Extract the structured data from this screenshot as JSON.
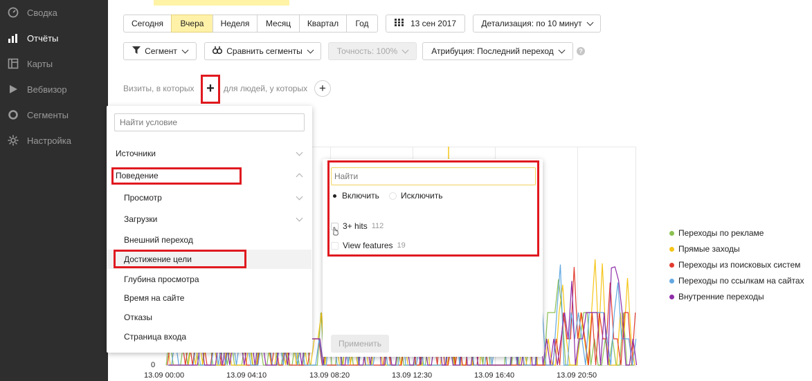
{
  "sidebar": {
    "items": [
      {
        "label": "Сводка",
        "icon": "gauge-icon",
        "active": false
      },
      {
        "label": "Отчёты",
        "icon": "bar-chart-icon",
        "active": true
      },
      {
        "label": "Карты",
        "icon": "map-icon",
        "active": false
      },
      {
        "label": "Вебвизор",
        "icon": "play-icon",
        "active": false
      },
      {
        "label": "Сегменты",
        "icon": "segment-icon",
        "active": false
      },
      {
        "label": "Настройка",
        "icon": "gear-icon",
        "active": false
      }
    ]
  },
  "periods": [
    "Сегодня",
    "Вчера",
    "Неделя",
    "Месяц",
    "Квартал",
    "Год"
  ],
  "selected_period": "Вчера",
  "date_label": "13 сен 2017",
  "detail_label": "Детализация: по 10 минут",
  "toolbar": {
    "segment_label": "Сегмент",
    "compare_label": "Сравнить сегменты",
    "accuracy_label": "Точность: 100%",
    "attribution_label": "Атрибуция: Последний переход",
    "help": "?"
  },
  "filter_row": {
    "visits_label": "Визиты, в которых",
    "people_label": "для людей, у которых",
    "plus": "+"
  },
  "condition_menu": {
    "search_placeholder": "Найти условие",
    "items": [
      {
        "label": "Источники",
        "chevron": "down"
      },
      {
        "label": "Поведение",
        "chevron": "up"
      },
      {
        "label": "Просмотр",
        "chevron": "down"
      },
      {
        "label": "Загрузки",
        "chevron": "down"
      },
      {
        "label": "Внешний переход",
        "chevron": ""
      },
      {
        "label": "Достижение цели",
        "chevron": ""
      },
      {
        "label": "Глубина просмотра",
        "chevron": ""
      },
      {
        "label": "Время на сайте",
        "chevron": ""
      },
      {
        "label": "Отказы",
        "chevron": ""
      },
      {
        "label": "Страница входа",
        "chevron": ""
      }
    ]
  },
  "goal_panel": {
    "search_placeholder": "Найти",
    "include_label": "Включить",
    "exclude_label": "Исключить",
    "goals": [
      {
        "label": "3+ hits",
        "count": "112"
      },
      {
        "label": "View features",
        "count": "19"
      }
    ],
    "apply_label": "Применить"
  },
  "chart_data": {
    "type": "line",
    "x_ticks": [
      "13.09 00:00",
      "13.09 04:10",
      "13.09 08:20",
      "13.09 12:30",
      "13.09 16:40",
      "13.09 20:50"
    ],
    "y_ticks": [
      "0"
    ],
    "series": [
      {
        "name": "Переходы по рекламе",
        "color": "#8cc152"
      },
      {
        "name": "Прямые заходы",
        "color": "#f5c518"
      },
      {
        "name": "Переходы из поисковых систем",
        "color": "#e23b2e"
      },
      {
        "name": "Переходы по ссылкам на сайтах",
        "color": "#63a8e0"
      },
      {
        "name": "Внутренние переходы",
        "color": "#8e2da8"
      }
    ]
  }
}
